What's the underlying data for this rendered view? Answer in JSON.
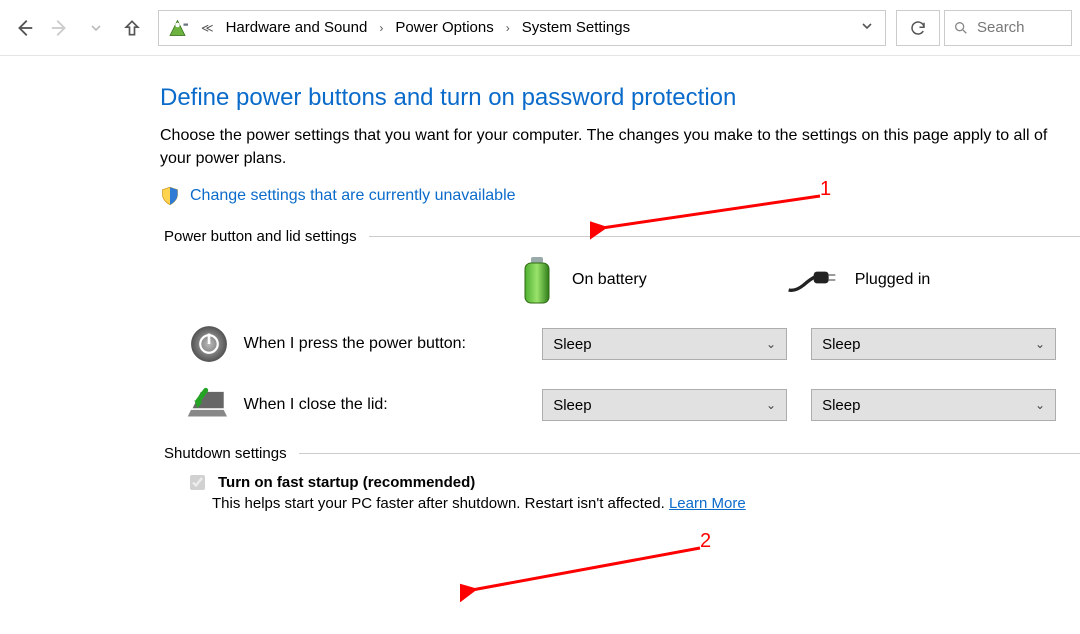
{
  "breadcrumb": {
    "items": [
      "Hardware and Sound",
      "Power Options",
      "System Settings"
    ]
  },
  "search": {
    "placeholder": "Search"
  },
  "title": "Define power buttons and turn on password protection",
  "description": "Choose the power settings that you want for your computer. The changes you make to the settings on this page apply to all of your power plans.",
  "change_link": "Change settings that are currently unavailable",
  "group1_header": "Power button and lid settings",
  "columns": {
    "battery": "On battery",
    "plugged": "Plugged in"
  },
  "rows": {
    "power_button": {
      "label": "When I press the power button:",
      "battery_value": "Sleep",
      "plugged_value": "Sleep"
    },
    "close_lid": {
      "label": "When I close the lid:",
      "battery_value": "Sleep",
      "plugged_value": "Sleep"
    }
  },
  "group2_header": "Shutdown settings",
  "fast_startup": {
    "checked": true,
    "label": "Turn on fast startup (recommended)",
    "description": "This helps start your PC faster after shutdown. Restart isn't affected. ",
    "learn_more": "Learn More"
  },
  "annotations": {
    "one": "1",
    "two": "2"
  }
}
